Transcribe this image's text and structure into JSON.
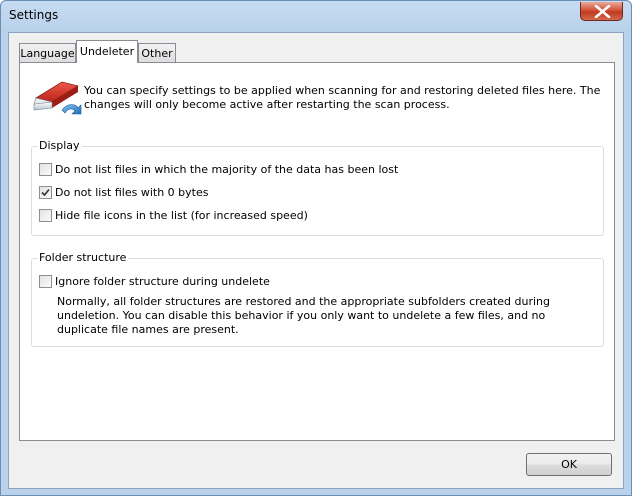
{
  "window": {
    "title": "Settings"
  },
  "tabs": [
    {
      "label": "Language",
      "active": false
    },
    {
      "label": "Undeleter",
      "active": true
    },
    {
      "label": "Other",
      "active": false
    }
  ],
  "intro": {
    "text": "You can specify settings to be applied when scanning for and restoring deleted files here. The changes will only become active after restarting the scan process.",
    "icon": "eraser-undo-icon"
  },
  "display_group": {
    "legend": "Display",
    "options": [
      {
        "label": "Do not list files in which the majority of the data has been lost",
        "checked": false
      },
      {
        "label": "Do not list files with 0 bytes",
        "checked": true
      },
      {
        "label": "Hide file icons in the list (for increased speed)",
        "checked": false
      }
    ]
  },
  "folder_group": {
    "legend": "Folder structure",
    "option": {
      "label": "Ignore folder structure during undelete",
      "checked": false
    },
    "description": "Normally, all folder structures are restored and the appropriate subfolders created during undeletion. You can disable this behavior if you only want to undelete a few files, and no duplicate file names are present."
  },
  "buttons": {
    "ok_label": "OK"
  },
  "colors": {
    "titlebar": "#b9d1ea",
    "close_button": "#c13a1f",
    "dialog_bg": "#f0f0f0"
  }
}
